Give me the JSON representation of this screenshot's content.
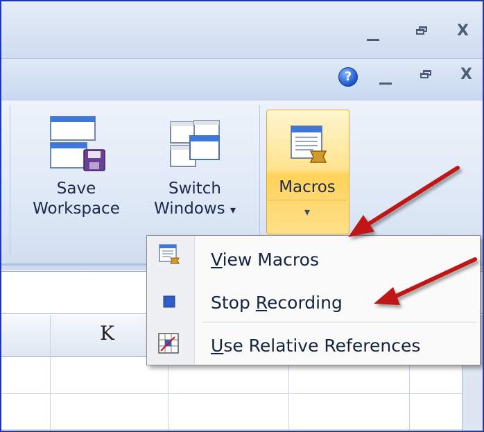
{
  "window": {
    "app_controls": {
      "minimize": "_",
      "restore": "restore",
      "close": "X"
    },
    "doc_controls": {
      "help": "?",
      "minimize": "_",
      "restore": "restore",
      "close": "X"
    }
  },
  "ribbon": {
    "save_workspace": {
      "line1": "Save",
      "line2": "Workspace",
      "icon": "save-workspace-icon"
    },
    "switch_windows": {
      "line1": "Switch",
      "line2": "Windows",
      "dropdown": "▾",
      "icon": "switch-windows-icon"
    },
    "macros": {
      "label": "Macros",
      "dropdown": "▾",
      "icon": "macros-icon"
    }
  },
  "menu": {
    "items": [
      {
        "pre": "",
        "accel": "V",
        "post": "iew Macros",
        "icon": "view-macros-icon"
      },
      {
        "pre": "Stop ",
        "accel": "R",
        "post": "ecording",
        "icon": "stop-recording-icon"
      },
      {
        "pre": "",
        "accel": "U",
        "post": "se Relative References",
        "icon": "relative-references-icon"
      }
    ]
  },
  "sheet": {
    "visible_column": "K"
  },
  "colors": {
    "arrow": "#c01818",
    "highlight": "#ffd25a",
    "title_bar": "#dbe6f5"
  }
}
